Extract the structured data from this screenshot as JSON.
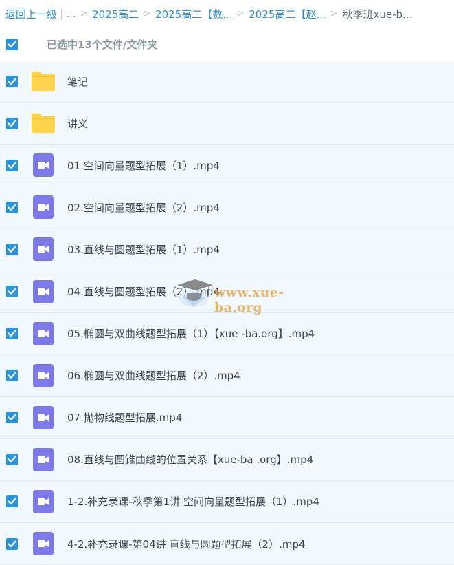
{
  "breadcrumb": {
    "back_label": "返回上一级",
    "bar": "|",
    "ellipsis": "...",
    "sep": ">",
    "crumbs": [
      "2025高二",
      "2025高二【数...",
      "2025高二【赵..."
    ],
    "current": "秋季班xue-b..."
  },
  "selection": {
    "summary": "已选中13个文件/文件夹"
  },
  "files": [
    {
      "name": "笔记",
      "type": "folder"
    },
    {
      "name": "讲义",
      "type": "folder"
    },
    {
      "name": "01.空间向量题型拓展（1）.mp4",
      "type": "video"
    },
    {
      "name": "02.空间向量题型拓展（2）.mp4",
      "type": "video"
    },
    {
      "name": "03.直线与圆题型拓展（1）.mp4",
      "type": "video"
    },
    {
      "name": "04.直线与圆题型拓展（2）.mp4",
      "type": "video"
    },
    {
      "name": "05.椭圆与双曲线题型拓展（1）【xue -ba.org】.mp4",
      "type": "video"
    },
    {
      "name": "06.椭圆与双曲线题型拓展（2）.mp4",
      "type": "video"
    },
    {
      "name": "07.抛物线题型拓展.mp4",
      "type": "video"
    },
    {
      "name": "08.直线与圆锥曲线的位置关系【xue-ba .org】.mp4",
      "type": "video"
    },
    {
      "name": "1-2.补充录课-秋季第1讲 空间向量题型拓展（1）.mp4",
      "type": "video"
    },
    {
      "name": "4-2.补充录课-第04讲 直线与圆题型拓展（2）.mp4",
      "type": "video"
    }
  ],
  "watermark": {
    "text": "www.xue-ba.org"
  },
  "colors": {
    "accent": "#2b93d9",
    "folder": "#ffd24d",
    "video": "#7d79e6",
    "row_bg": "#f2f9fe"
  },
  "icons": {
    "checkbox": "checkmark-icon",
    "folder": "folder-icon",
    "video": "video-file-icon"
  }
}
